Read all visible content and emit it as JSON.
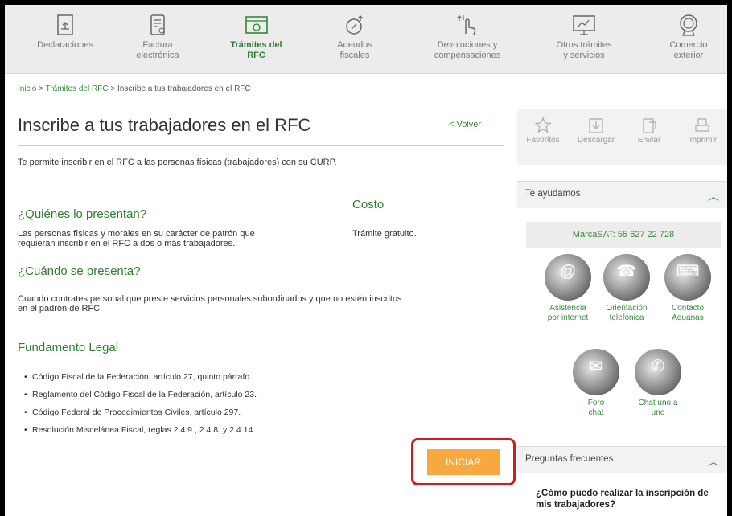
{
  "nav": {
    "items": [
      {
        "label": "Declaraciones",
        "icon": "declaraciones-icon"
      },
      {
        "label": "Factura\nelectrónica",
        "icon": "factura-icon"
      },
      {
        "label": "Trámites del\nRFC",
        "icon": "tramites-icon",
        "active": true
      },
      {
        "label": "Adeudos\nfiscales",
        "icon": "adeudos-icon"
      },
      {
        "label": "Devoluciones y\ncompensaciones",
        "icon": "devoluciones-icon"
      },
      {
        "label": "Otros trámites\ny servicios",
        "icon": "otros-icon"
      },
      {
        "label": "Comercio\nexterior",
        "icon": "comercio-icon"
      }
    ]
  },
  "breadcrumb": {
    "home": "Inicio",
    "sep": ">",
    "section": "Trámites del RFC",
    "current": "Inscribe a tus trabajadores en el RFC"
  },
  "page": {
    "title": "Inscribe a tus trabajadores en el RFC",
    "back": "< Volver",
    "description": "Te permite inscribir en el RFC a las personas físicas (trabajadores) con su CURP."
  },
  "sections": {
    "quienes_h": "¿Quiénes lo presentan?",
    "quienes_text_1": "Las personas físicas y morales en su carácter de patrón que",
    "quienes_text_2": "requieran inscribir en el RFC a dos o más trabajadores.",
    "costo_h": "Costo",
    "costo_text": "Trámite gratuito.",
    "cuando_h": "¿Cuándo se presenta?",
    "cuando_text_1": "Cuando contrates personal que preste servicios personales subordinados y que no estén inscritos",
    "cuando_text_2": "en el padrón de RFC.",
    "fundamento_h": "Fundamento Legal",
    "fundamento": [
      "Código Fiscal de la Federación, artículo 27, quinto párrafo.",
      "Reglamento del Código Fiscal de la Federación, artículo 23.",
      "Código Federal de Procedimientos Civiles, artículo 297.",
      "Resolución Miscelánea Fiscal, reglas 2.4.9., 2.4.8. y 2.4.14."
    ]
  },
  "iniciar": "INICIAR",
  "sidebar": {
    "actions": [
      {
        "label": "Favoritos",
        "icon": "star-icon"
      },
      {
        "label": "Descargar",
        "icon": "download-icon"
      },
      {
        "label": "Enviar",
        "icon": "send-icon"
      },
      {
        "label": "Imprimir",
        "icon": "print-icon"
      }
    ],
    "te_ayudamos": "Te ayudamos",
    "marcasat": "MarcaSAT: 55 627 22 728",
    "help": [
      {
        "label": "Asistencia\npor internet",
        "icon": "at-icon"
      },
      {
        "label": "Orientación\ntelefónica",
        "icon": "phone-agent-icon"
      },
      {
        "label": "Contacto\nAduanas",
        "icon": "keyboard-icon"
      },
      {
        "label": "Foro\nchat",
        "icon": "forum-icon"
      },
      {
        "label": "Chat uno a\nuno",
        "icon": "chat-icon"
      }
    ],
    "faq_h": "Preguntas frecuentes",
    "faq_q": "¿Cómo puedo realizar la inscripción de mis trabajadores?"
  },
  "colors": {
    "accent": "#2e7d32",
    "button": "#f7a83e",
    "highlight": "#d41b1b"
  }
}
